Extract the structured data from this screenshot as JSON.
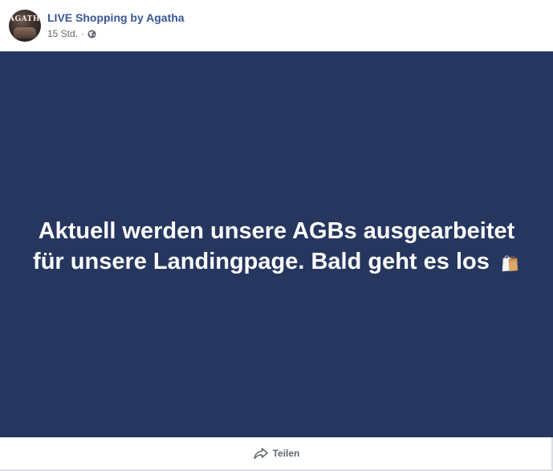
{
  "post": {
    "page_name": "LIVE Shopping by Agatha",
    "avatar_text": "AGATHA",
    "timestamp": "15 Std.",
    "meta_separator": "·",
    "privacy_icon": "globe-icon",
    "status_line_1": "Aktuell werden unsere AGBs ausgearbeitet",
    "status_line_2": "für unsere Landingpage. Bald geht es los",
    "status_emoji_icon": "shopping-bags-icon",
    "background_color": "#25365f"
  },
  "actions": {
    "share_label": "Teilen",
    "share_icon": "share-arrow-icon"
  },
  "colors": {
    "link": "#385898",
    "secondary_text": "#606770",
    "divider": "#dadde1"
  }
}
